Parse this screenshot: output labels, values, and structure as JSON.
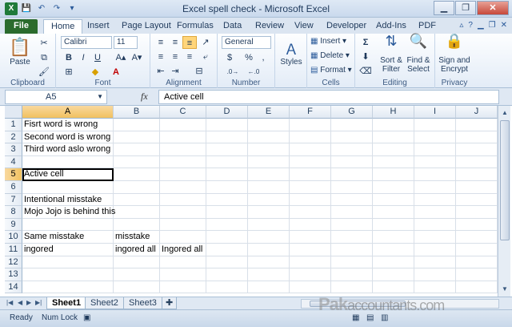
{
  "window": {
    "title": "Excel spell check - Microsoft Excel",
    "minimize": "▁",
    "restore": "❐",
    "close": "✕"
  },
  "tabs": [
    {
      "label": "File"
    },
    {
      "label": "Home"
    },
    {
      "label": "Insert"
    },
    {
      "label": "Page Layout"
    },
    {
      "label": "Formulas"
    },
    {
      "label": "Data"
    },
    {
      "label": "Review"
    },
    {
      "label": "View"
    },
    {
      "label": "Developer"
    },
    {
      "label": "Add-Ins"
    },
    {
      "label": "PDF"
    }
  ],
  "ribbon": {
    "clipboard": {
      "paste": "Paste",
      "label": "Clipboard"
    },
    "font": {
      "name": "Calibri",
      "size": "11",
      "bold": "B",
      "italic": "I",
      "underline": "U",
      "label": "Font"
    },
    "alignment": {
      "label": "Alignment"
    },
    "number": {
      "format": "General",
      "currency": "$",
      "percent": "%",
      "comma": ",",
      "label": "Number"
    },
    "styles": {
      "styles": "Styles"
    },
    "cells": {
      "insert": "Insert",
      "delete": "Delete",
      "format": "Format",
      "label": "Cells"
    },
    "editing": {
      "sum": "Σ",
      "sort": "Sort &",
      "filter": "Filter",
      "find": "Find &",
      "select": "Select",
      "label": "Editing"
    },
    "privacy": {
      "sign": "Sign and",
      "encrypt": "Encrypt",
      "label": "Privacy"
    }
  },
  "formula_bar": {
    "name_box": "A5",
    "fx": "fx",
    "content": "Active cell"
  },
  "columns": [
    "A",
    "B",
    "C",
    "D",
    "E",
    "F",
    "G",
    "H",
    "I",
    "J"
  ],
  "rows": [
    "1",
    "2",
    "3",
    "4",
    "5",
    "6",
    "7",
    "8",
    "9",
    "10",
    "11",
    "12",
    "13",
    "14"
  ],
  "cells": {
    "A1": "Fisrt word is wrong",
    "A2": "Second word is wrong",
    "A3": "Third word aslo wrong",
    "A5": "Active cell",
    "A7": "Intentional misstake",
    "A8": "Mojo Jojo is behind this",
    "A10": "Same misstake",
    "B10": "misstake",
    "A11": "ingored",
    "B11": "ingored all",
    "C11": "Ingored all"
  },
  "sheets": [
    {
      "label": "Sheet1"
    },
    {
      "label": "Sheet2"
    },
    {
      "label": "Sheet3"
    }
  ],
  "status": {
    "ready": "Ready",
    "numlock": "Num Lock"
  },
  "watermark": {
    "brand": "Pak",
    "rest": "accountants.com"
  }
}
